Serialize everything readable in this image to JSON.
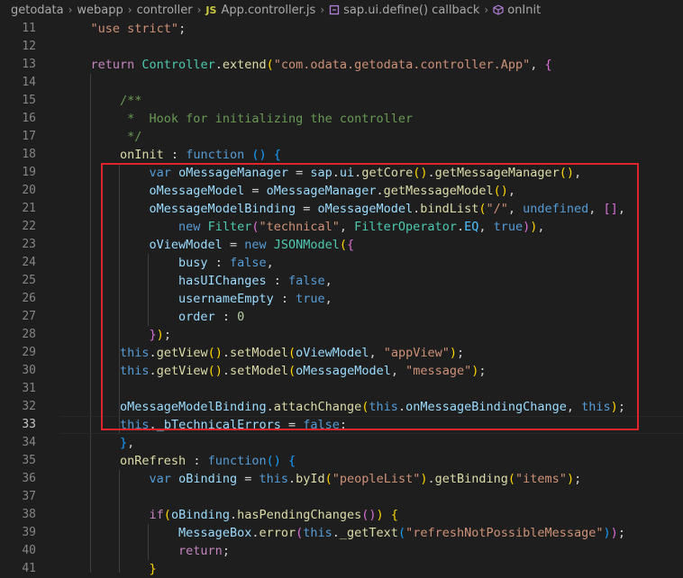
{
  "breadcrumb": {
    "items": [
      "getodata",
      "webapp",
      "controller",
      "App.controller.js",
      "sap.ui.define() callback",
      "onInit"
    ],
    "js_badge": "JS"
  },
  "editor": {
    "current_line": 33,
    "lines": [
      {
        "n": 11,
        "tokens": [
          [
            "t-str",
            "\"use strict\""
          ],
          [
            "t-plain",
            ";"
          ]
        ]
      },
      {
        "n": 12,
        "tokens": []
      },
      {
        "n": 13,
        "tokens": [
          [
            "t-ctl",
            "return "
          ],
          [
            "t-cls",
            "Controller"
          ],
          [
            "t-plain",
            "."
          ],
          [
            "t-fn",
            "extend"
          ],
          [
            "b1",
            "("
          ],
          [
            "t-str",
            "\"com.odata.getodata.controller.App\""
          ],
          [
            "t-plain",
            ", "
          ],
          [
            "b2",
            "{"
          ]
        ]
      },
      {
        "n": 14,
        "tokens": []
      },
      {
        "n": 15,
        "tokens": [
          [
            "t-com",
            "    /**"
          ]
        ]
      },
      {
        "n": 16,
        "tokens": [
          [
            "t-com",
            "     *  Hook for initializing the controller"
          ]
        ]
      },
      {
        "n": 17,
        "tokens": [
          [
            "t-com",
            "     */"
          ]
        ]
      },
      {
        "n": 18,
        "tokens": [
          [
            "t-fn",
            "    onInit"
          ],
          [
            "t-plain",
            " : "
          ],
          [
            "t-kw",
            "function"
          ],
          [
            "t-plain",
            " "
          ],
          [
            "b3",
            "()"
          ],
          [
            "t-plain",
            " "
          ],
          [
            "b3",
            "{"
          ]
        ]
      },
      {
        "n": 19,
        "tokens": [
          [
            "t-kw",
            "        var "
          ],
          [
            "t-var",
            "oMessageManager"
          ],
          [
            "t-plain",
            " = "
          ],
          [
            "t-var",
            "sap"
          ],
          [
            "t-plain",
            "."
          ],
          [
            "t-var",
            "ui"
          ],
          [
            "t-plain",
            "."
          ],
          [
            "t-fn",
            "getCore"
          ],
          [
            "b1",
            "()"
          ],
          [
            "t-plain",
            "."
          ],
          [
            "t-fn",
            "getMessageManager"
          ],
          [
            "b1",
            "()"
          ],
          [
            "t-plain",
            ","
          ]
        ]
      },
      {
        "n": 20,
        "tokens": [
          [
            "t-var",
            "        oMessageModel"
          ],
          [
            "t-plain",
            " = "
          ],
          [
            "t-var",
            "oMessageManager"
          ],
          [
            "t-plain",
            "."
          ],
          [
            "t-fn",
            "getMessageModel"
          ],
          [
            "b1",
            "()"
          ],
          [
            "t-plain",
            ","
          ]
        ]
      },
      {
        "n": 21,
        "tokens": [
          [
            "t-var",
            "        oMessageModelBinding"
          ],
          [
            "t-plain",
            " = "
          ],
          [
            "t-var",
            "oMessageModel"
          ],
          [
            "t-plain",
            "."
          ],
          [
            "t-fn",
            "bindList"
          ],
          [
            "b1",
            "("
          ],
          [
            "t-str",
            "\"/\""
          ],
          [
            "t-plain",
            ", "
          ],
          [
            "t-kw",
            "undefined"
          ],
          [
            "t-plain",
            ", "
          ],
          [
            "b2",
            "[]"
          ],
          [
            "t-plain",
            ","
          ]
        ]
      },
      {
        "n": 22,
        "tokens": [
          [
            "t-kw",
            "            new "
          ],
          [
            "t-cls",
            "Filter"
          ],
          [
            "b2",
            "("
          ],
          [
            "t-str",
            "\"technical\""
          ],
          [
            "t-plain",
            ", "
          ],
          [
            "t-cls",
            "FilterOperator"
          ],
          [
            "t-plain",
            "."
          ],
          [
            "t-const",
            "EQ"
          ],
          [
            "t-plain",
            ", "
          ],
          [
            "t-kw",
            "true"
          ],
          [
            "b2",
            ")"
          ],
          [
            "b1",
            ")"
          ],
          [
            "t-plain",
            ","
          ]
        ]
      },
      {
        "n": 23,
        "tokens": [
          [
            "t-var",
            "        oViewModel"
          ],
          [
            "t-plain",
            " = "
          ],
          [
            "t-kw",
            "new "
          ],
          [
            "t-cls",
            "JSONModel"
          ],
          [
            "b1",
            "("
          ],
          [
            "b2",
            "{"
          ]
        ]
      },
      {
        "n": 24,
        "tokens": [
          [
            "t-var",
            "            busy"
          ],
          [
            "t-plain",
            " : "
          ],
          [
            "t-kw",
            "false"
          ],
          [
            "t-plain",
            ","
          ]
        ]
      },
      {
        "n": 25,
        "tokens": [
          [
            "t-var",
            "            hasUIChanges"
          ],
          [
            "t-plain",
            " : "
          ],
          [
            "t-kw",
            "false"
          ],
          [
            "t-plain",
            ","
          ]
        ]
      },
      {
        "n": 26,
        "tokens": [
          [
            "t-var",
            "            usernameEmpty"
          ],
          [
            "t-plain",
            " : "
          ],
          [
            "t-kw",
            "true"
          ],
          [
            "t-plain",
            ","
          ]
        ]
      },
      {
        "n": 27,
        "tokens": [
          [
            "t-var",
            "            order"
          ],
          [
            "t-plain",
            " : "
          ],
          [
            "t-num",
            "0"
          ]
        ]
      },
      {
        "n": 28,
        "tokens": [
          [
            "b2",
            "        }"
          ],
          [
            "b1",
            ")"
          ],
          [
            "t-plain",
            ";"
          ]
        ]
      },
      {
        "n": 29,
        "tokens": [
          [
            "t-kw",
            "    this"
          ],
          [
            "t-plain",
            "."
          ],
          [
            "t-fn",
            "getView"
          ],
          [
            "b1",
            "()"
          ],
          [
            "t-plain",
            "."
          ],
          [
            "t-fn",
            "setModel"
          ],
          [
            "b1",
            "("
          ],
          [
            "t-var",
            "oViewModel"
          ],
          [
            "t-plain",
            ", "
          ],
          [
            "t-str",
            "\"appView\""
          ],
          [
            "b1",
            ")"
          ],
          [
            "t-plain",
            ";"
          ]
        ]
      },
      {
        "n": 30,
        "tokens": [
          [
            "t-kw",
            "    this"
          ],
          [
            "t-plain",
            "."
          ],
          [
            "t-fn",
            "getView"
          ],
          [
            "b1",
            "()"
          ],
          [
            "t-plain",
            "."
          ],
          [
            "t-fn",
            "setModel"
          ],
          [
            "b1",
            "("
          ],
          [
            "t-var",
            "oMessageModel"
          ],
          [
            "t-plain",
            ", "
          ],
          [
            "t-str",
            "\"message\""
          ],
          [
            "b1",
            ")"
          ],
          [
            "t-plain",
            ";"
          ]
        ]
      },
      {
        "n": 31,
        "tokens": []
      },
      {
        "n": 32,
        "tokens": [
          [
            "t-var",
            "    oMessageModelBinding"
          ],
          [
            "t-plain",
            "."
          ],
          [
            "t-fn",
            "attachChange"
          ],
          [
            "b1",
            "("
          ],
          [
            "t-kw",
            "this"
          ],
          [
            "t-plain",
            "."
          ],
          [
            "t-var",
            "onMessageBindingChange"
          ],
          [
            "t-plain",
            ", "
          ],
          [
            "t-kw",
            "this"
          ],
          [
            "b1",
            ")"
          ],
          [
            "t-plain",
            ";"
          ]
        ]
      },
      {
        "n": 33,
        "tokens": [
          [
            "t-kw",
            "    this"
          ],
          [
            "t-plain",
            "."
          ],
          [
            "t-var",
            "_bTechnicalErrors"
          ],
          [
            "t-plain",
            " = "
          ],
          [
            "t-kw",
            "false"
          ],
          [
            "t-plain",
            ";"
          ]
        ]
      },
      {
        "n": 34,
        "tokens": [
          [
            "b3",
            "    }"
          ],
          [
            "t-plain",
            ","
          ]
        ]
      },
      {
        "n": 35,
        "tokens": [
          [
            "t-fn",
            "    onRefresh"
          ],
          [
            "t-plain",
            " : "
          ],
          [
            "t-kw",
            "function"
          ],
          [
            "b3",
            "()"
          ],
          [
            "t-plain",
            " "
          ],
          [
            "b3",
            "{"
          ]
        ]
      },
      {
        "n": 36,
        "tokens": [
          [
            "t-kw",
            "        var "
          ],
          [
            "t-var",
            "oBinding"
          ],
          [
            "t-plain",
            " = "
          ],
          [
            "t-kw",
            "this"
          ],
          [
            "t-plain",
            "."
          ],
          [
            "t-fn",
            "byId"
          ],
          [
            "b1",
            "("
          ],
          [
            "t-str",
            "\"peopleList\""
          ],
          [
            "b1",
            ")"
          ],
          [
            "t-plain",
            "."
          ],
          [
            "t-fn",
            "getBinding"
          ],
          [
            "b1",
            "("
          ],
          [
            "t-str",
            "\"items\""
          ],
          [
            "b1",
            ")"
          ],
          [
            "t-plain",
            ";"
          ]
        ]
      },
      {
        "n": 37,
        "tokens": []
      },
      {
        "n": 38,
        "tokens": [
          [
            "t-ctl",
            "        if"
          ],
          [
            "b1",
            "("
          ],
          [
            "t-var",
            "oBinding"
          ],
          [
            "t-plain",
            "."
          ],
          [
            "t-fn",
            "hasPendingChanges"
          ],
          [
            "b2",
            "()"
          ],
          [
            "b1",
            ")"
          ],
          [
            "t-plain",
            " "
          ],
          [
            "b1",
            "{"
          ]
        ]
      },
      {
        "n": 39,
        "tokens": [
          [
            "t-var",
            "            MessageBox"
          ],
          [
            "t-plain",
            "."
          ],
          [
            "t-fn",
            "error"
          ],
          [
            "b2",
            "("
          ],
          [
            "t-kw",
            "this"
          ],
          [
            "t-plain",
            "."
          ],
          [
            "t-fn",
            "_getText"
          ],
          [
            "b3",
            "("
          ],
          [
            "t-str",
            "\"refreshNotPossibleMessage\""
          ],
          [
            "b3",
            ")"
          ],
          [
            "b2",
            ")"
          ],
          [
            "t-plain",
            ";"
          ]
        ]
      },
      {
        "n": 40,
        "tokens": [
          [
            "t-ctl",
            "            return"
          ],
          [
            "t-plain",
            ";"
          ]
        ]
      },
      {
        "n": 41,
        "tokens": [
          [
            "b1",
            "        }"
          ]
        ]
      }
    ]
  }
}
